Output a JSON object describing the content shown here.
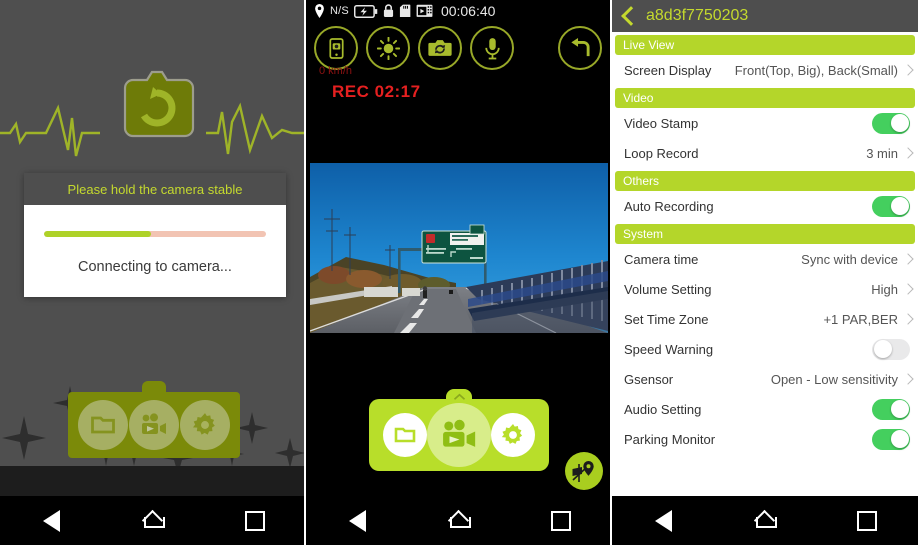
{
  "panel1": {
    "name": "connecting-screen",
    "icon": "camera-refresh-icon",
    "dialog": {
      "title": "Please hold the camera stable",
      "progress_percent": 48,
      "status": "Connecting to camera...",
      "progress_color": "#aed228",
      "track_color": "#f2c4b3"
    },
    "dock": [
      {
        "name": "folder-icon",
        "label": "Files"
      },
      {
        "name": "camcorder-icon",
        "label": "Record"
      },
      {
        "name": "gear-icon",
        "label": "Settings"
      }
    ]
  },
  "panel2": {
    "name": "live-view-screen",
    "statusbar": {
      "gps_label": "N/S",
      "gps_icon": "location-pin-icon",
      "battery_icon": "battery-charging-icon",
      "lock_icon": "lock-icon",
      "sdcard_icon": "sdcard-icon",
      "film_icon": "film-strip-icon",
      "clock": "00:06:40"
    },
    "tools": [
      {
        "name": "phone-snapshot-icon",
        "label": "Snapshot to phone"
      },
      {
        "name": "brightness-icon",
        "label": "Brightness"
      },
      {
        "name": "camera-switch-icon",
        "label": "Switch camera"
      },
      {
        "name": "microphone-icon",
        "label": "Microphone"
      }
    ],
    "back_icon": "return-arrow-icon",
    "speed": "0 km/h",
    "rec": "REC 02:17",
    "speed_color": "#8e1212",
    "rec_color": "#e52020",
    "dock": [
      {
        "name": "folder-icon",
        "label": "Files"
      },
      {
        "name": "camcorder-icon",
        "label": "Record"
      },
      {
        "name": "gear-icon",
        "label": "Settings"
      }
    ],
    "gps_button_icon": "gps-map-marker-icon",
    "accent_color": "#b8de2a"
  },
  "panel3": {
    "name": "settings-screen",
    "header": {
      "back_icon": "chevron-left-icon",
      "title": "a8d3f7750203"
    },
    "sections": [
      {
        "title": "Live View",
        "rows": [
          {
            "label": "Screen Display",
            "value": "Front(Top, Big), Back(Small)",
            "type": "chevron"
          }
        ]
      },
      {
        "title": "Video",
        "rows": [
          {
            "label": "Video Stamp",
            "value": "",
            "type": "toggle",
            "state": "on"
          },
          {
            "label": "Loop Record",
            "value": "3 min",
            "type": "chevron"
          }
        ]
      },
      {
        "title": "Others",
        "rows": [
          {
            "label": "Auto Recording",
            "value": "",
            "type": "toggle",
            "state": "on"
          }
        ]
      },
      {
        "title": "System",
        "rows": [
          {
            "label": "Camera time",
            "value": "Sync with device",
            "type": "chevron"
          },
          {
            "label": "Volume Setting",
            "value": "High",
            "type": "chevron"
          },
          {
            "label": "Set Time Zone",
            "value": "+1 PAR,BER",
            "type": "chevron"
          },
          {
            "label": "Speed Warning",
            "value": "",
            "type": "toggle",
            "state": "off"
          },
          {
            "label": "Gsensor",
            "value": "Open - Low sensitivity",
            "type": "chevron"
          },
          {
            "label": "Audio Setting",
            "value": "",
            "type": "toggle",
            "state": "on"
          },
          {
            "label": "Parking Monitor",
            "value": "",
            "type": "toggle",
            "state": "on"
          }
        ]
      }
    ],
    "section_color": "#b4d62a",
    "toggle_on_color": "#44cf5e",
    "toggle_off_color": "#e9e9ea"
  },
  "navbar": {
    "back_icon": "triangle-back-icon",
    "home_icon": "home-icon",
    "recents_icon": "square-recents-icon"
  }
}
